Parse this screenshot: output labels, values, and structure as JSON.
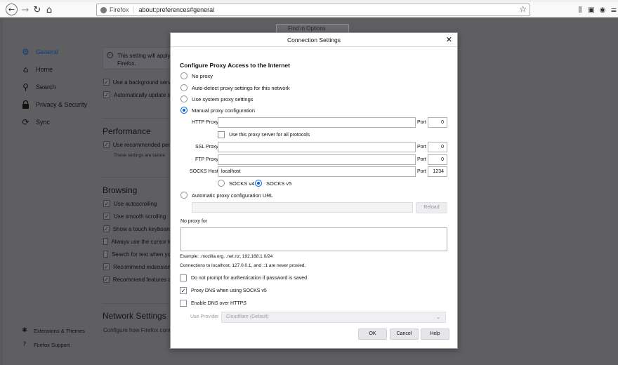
{
  "browser": {
    "identity_label": "Firefox",
    "url": "about:preferences#general",
    "icons": [
      "back-icon",
      "forward-icon",
      "reload-icon",
      "home-icon",
      "bookmark-star-icon",
      "library-icon",
      "sidebar-icon",
      "account-icon",
      "menu-icon"
    ]
  },
  "prefs": {
    "find_placeholder": "Find in Options",
    "sidebar": [
      {
        "label": "General",
        "icon": "gear-icon",
        "active": true
      },
      {
        "label": "Home",
        "icon": "home-icon"
      },
      {
        "label": "Search",
        "icon": "search-icon"
      },
      {
        "label": "Privacy & Security",
        "icon": "lock-icon"
      },
      {
        "label": "Sync",
        "icon": "sync-icon"
      }
    ],
    "sidebar_bottom": [
      {
        "label": "Extensions & Themes",
        "icon": "puzzle-icon"
      },
      {
        "label": "Firefox Support",
        "icon": "help-icon"
      }
    ],
    "info_text_1": "This setting will apply",
    "info_text_2": "Firefox.",
    "startup_checks": [
      {
        "label": "Use a background servi",
        "checked": true
      },
      {
        "label": "Automatically update s",
        "checked": true
      }
    ],
    "performance_title": "Performance",
    "performance_check": {
      "label": "Use recommended perf",
      "checked": true
    },
    "performance_sub": "These settings are tailore",
    "browsing_title": "Browsing",
    "browsing_checks": [
      {
        "label": "Use autoscrolling",
        "checked": true
      },
      {
        "label": "Use smooth scrolling",
        "checked": true
      },
      {
        "label": "Show a touch keyboard",
        "checked": true
      },
      {
        "label": "Always use the cursor k",
        "checked": false
      },
      {
        "label": "Search for text when yo",
        "checked": false
      },
      {
        "label": "Recommend extension",
        "checked": true
      },
      {
        "label": "Recommend features a",
        "checked": true
      }
    ],
    "network_title": "Network Settings",
    "network_sub": "Configure how Firefox conn"
  },
  "dialog": {
    "title": "Connection Settings",
    "close_glyph": "✕",
    "heading": "Configure Proxy Access to the Internet",
    "proxy_options": [
      {
        "label": "No proxy",
        "selected": false
      },
      {
        "label": "Auto-detect proxy settings for this network",
        "selected": false
      },
      {
        "label": "Use system proxy settings",
        "selected": false
      },
      {
        "label": "Manual proxy configuration",
        "selected": true
      }
    ],
    "http": {
      "label": "HTTP Proxy",
      "value": "",
      "port_label": "Port",
      "port": "0"
    },
    "use_for_all": {
      "label": "Use this proxy server for all protocols",
      "checked": false
    },
    "ssl": {
      "label": "SSL Proxy",
      "value": "",
      "port_label": "Port",
      "port": "0"
    },
    "ftp": {
      "label": "FTP Proxy",
      "value": "",
      "port_label": "Port",
      "port": "0"
    },
    "socks": {
      "label": "SOCKS Host",
      "value": "localhost",
      "port_label": "Port",
      "port": "1234"
    },
    "socks_v4": {
      "label": "SOCKS v4",
      "selected": false
    },
    "socks_v5": {
      "label": "SOCKS v5",
      "selected": true
    },
    "auto_config": {
      "label": "Automatic proxy configuration URL",
      "selected": false,
      "url": "",
      "reload_label": "Reload"
    },
    "no_proxy_label": "No proxy for",
    "no_proxy_value": "",
    "example": "Example: .mozilla.org, .net.nz, 192.168.1.0/24",
    "localhost_note": "Connections to localhost, 127.0.0.1, and ::1 are never proxied.",
    "checks": [
      {
        "label": "Do not prompt for authentication if password is saved",
        "checked": false
      },
      {
        "label": "Proxy DNS when using SOCKS v5",
        "checked": true
      },
      {
        "label": "Enable DNS over HTTPS",
        "checked": false
      }
    ],
    "provider_label": "Use Provider",
    "provider_value": "Cloudflare (Default)",
    "ok_label": "OK",
    "cancel_label": "Cancel",
    "help_label": "Help"
  }
}
